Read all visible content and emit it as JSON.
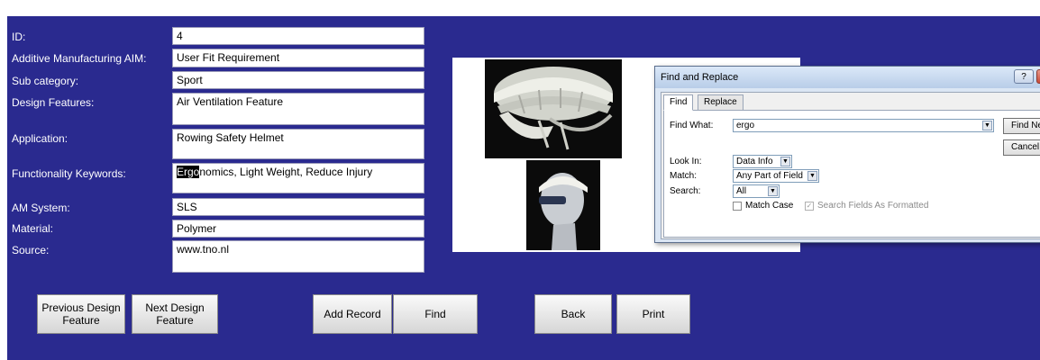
{
  "form": {
    "labels": {
      "id": "ID:",
      "aim": "Additive Manufacturing AIM:",
      "subcat": "Sub category:",
      "design": "Design Features:",
      "application": "Application:",
      "keywords": "Functionality Keywords:",
      "am_system": "AM System:",
      "material": "Material:",
      "source": "Source:"
    },
    "values": {
      "id": "4",
      "aim": "User Fit Requirement",
      "subcat": "Sport",
      "design": "Air Ventilation Feature",
      "application": "Rowing Safety Helmet",
      "keywords_hl": "Ergo",
      "keywords_rest": "nomics, Light Weight, Reduce Injury",
      "am_system": "SLS",
      "material": "Polymer",
      "source": "www.tno.nl"
    }
  },
  "buttons": {
    "prev_line1": "Previous Design",
    "prev_line2": "Feature",
    "next_line1": "Next Design",
    "next_line2": "Feature",
    "add": "Add Record",
    "find": "Find",
    "back": "Back",
    "print": "Print"
  },
  "dialog": {
    "title": "Find and Replace",
    "help": "?",
    "tab_find": "Find",
    "tab_replace": "Replace",
    "find_what_label": "Find What:",
    "find_what_value": "ergo",
    "find_next": "Find Next",
    "cancel": "Cancel",
    "look_in_label": "Look In:",
    "look_in_value": "Data Info",
    "match_label": "Match:",
    "match_value": "Any Part of Field",
    "search_label": "Search:",
    "search_value": "All",
    "match_case": "Match Case",
    "search_formatted": "Search Fields As Formatted"
  }
}
